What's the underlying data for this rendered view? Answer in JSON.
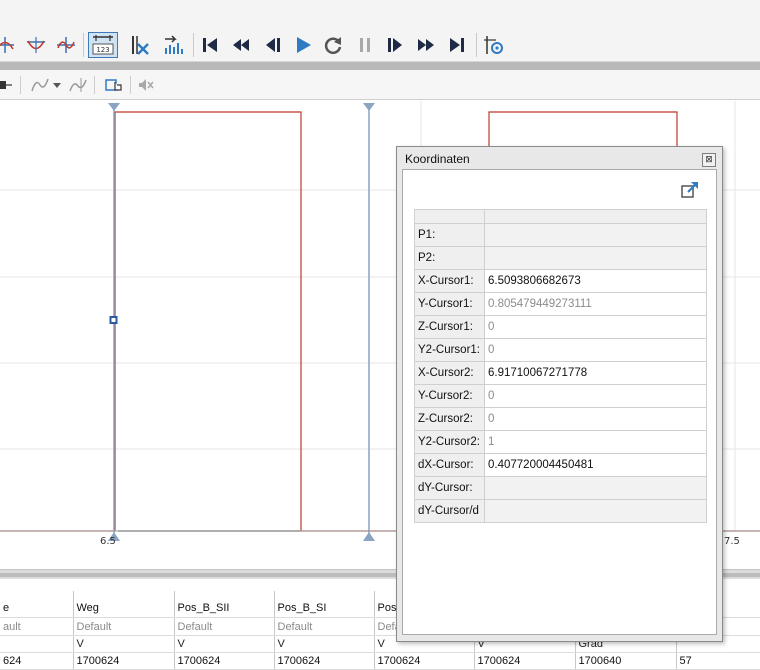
{
  "toolbar": {
    "main_buttons": [
      {
        "name": "cursor-peak-icon"
      },
      {
        "name": "cursor-valley-icon"
      },
      {
        "name": "cursor-cross-icon"
      },
      {
        "name": "show-coordinates-icon",
        "label": "123",
        "pressed": true
      },
      {
        "name": "remove-cursor-icon"
      },
      {
        "name": "zoom-bars-icon"
      },
      {
        "name": "skip-to-start-icon"
      },
      {
        "name": "fast-rewind-icon"
      },
      {
        "name": "step-back-icon"
      },
      {
        "name": "play-icon"
      },
      {
        "name": "repeat-icon"
      },
      {
        "name": "pause-icon"
      },
      {
        "name": "step-forward-icon"
      },
      {
        "name": "fast-forward-icon"
      },
      {
        "name": "skip-to-end-icon"
      },
      {
        "name": "cursor-settings-icon"
      }
    ]
  },
  "plot": {
    "x_tick_left": "6.5",
    "x_tick_right": "7.5",
    "signal_color": "#c0392b",
    "cursor_color": "#8aa4c2"
  },
  "channels": {
    "rows": [
      {
        "cells": [
          "e",
          "Weg",
          "Pos_B_SII",
          "Pos_B_SI",
          "Pos_",
          "",
          "",
          ""
        ]
      },
      {
        "cells": [
          "ault",
          "Default",
          "Default",
          "Default",
          "Defa",
          "",
          "",
          ""
        ]
      },
      {
        "cells": [
          "",
          "V",
          "V",
          "V",
          "V",
          "V",
          "Grad",
          ""
        ]
      },
      {
        "cells": [
          "624",
          "1700624",
          "1700624",
          "1700624",
          "1700624",
          "1700624",
          "1700640",
          "57"
        ]
      }
    ]
  },
  "coordinates_dialog": {
    "title": "Koordinaten",
    "close_label": "⊠",
    "rows": [
      {
        "label": "P1:",
        "value": ""
      },
      {
        "label": "P2:",
        "value": ""
      },
      {
        "label": "X-Cursor1:",
        "value": "6.5093806682673"
      },
      {
        "label": "Y-Cursor1:",
        "value": "0.805479449273111"
      },
      {
        "label": "Z-Cursor1:",
        "value": "0"
      },
      {
        "label": "Y2-Cursor1:",
        "value": "0"
      },
      {
        "label": "X-Cursor2:",
        "value": "6.91710067271778"
      },
      {
        "label": "Y-Cursor2:",
        "value": "0"
      },
      {
        "label": "Z-Cursor2:",
        "value": "0"
      },
      {
        "label": "Y2-Cursor2:",
        "value": "1"
      },
      {
        "label": "dX-Cursor:",
        "value": "0.407720004450481"
      },
      {
        "label": "dY-Cursor:",
        "value": ""
      },
      {
        "label": "dY-Cursor/d",
        "value": ""
      }
    ]
  }
}
